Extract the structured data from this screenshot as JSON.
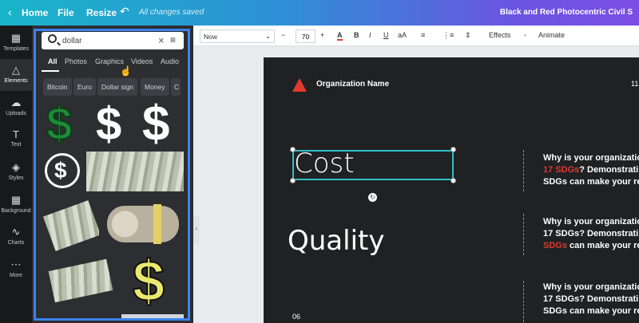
{
  "topbar": {
    "home": "Home",
    "file": "File",
    "resize": "Resize",
    "saved": "All changes saved",
    "title": "Black and Red Photocentric Civil S"
  },
  "rail": [
    {
      "label": "Templates",
      "icon": "grid-icon"
    },
    {
      "label": "Elements",
      "icon": "shapes-icon"
    },
    {
      "label": "Uploads",
      "icon": "cloud-upload-icon"
    },
    {
      "label": "Text",
      "icon": "text-icon"
    },
    {
      "label": "Styles",
      "icon": "palette-icon"
    },
    {
      "label": "Background",
      "icon": "background-icon"
    },
    {
      "label": "Charts",
      "icon": "chart-icon"
    },
    {
      "label": "More",
      "icon": "more-icon"
    }
  ],
  "search": {
    "value": "dollar"
  },
  "tabs": [
    "All",
    "Photos",
    "Graphics",
    "Videos",
    "Audio"
  ],
  "chips": [
    "Bitcoin",
    "Euro",
    "Dollar sign",
    "Money",
    "C"
  ],
  "toolbar": {
    "font": "Now",
    "size": "70",
    "effects": "Effects",
    "animate": "Animate"
  },
  "canvas": {
    "org_name": "Organization Name",
    "page_top": "11",
    "title1": "Cost",
    "title2": "Quality",
    "page_num": "06",
    "para1": {
      "l1": "Why is your organizatio",
      "l2a": "17 SDGs",
      "l2b": "? Demonstratin",
      "l3": "SDGs can make your re"
    },
    "para2": {
      "l1": "Why is your organizatio",
      "l2": "17 SDGs? Demonstratin",
      "l3a": "SDGs",
      "l3b": " can make your re"
    },
    "para3": {
      "l1": "Why is your organizatio",
      "l2": "17 SDGs? Demonstratin",
      "l3": "SDGs can make your re"
    }
  },
  "colors": {
    "accent": "#3c82f0",
    "brand_red": "#e03a2e",
    "selection": "#2dc0c4"
  }
}
